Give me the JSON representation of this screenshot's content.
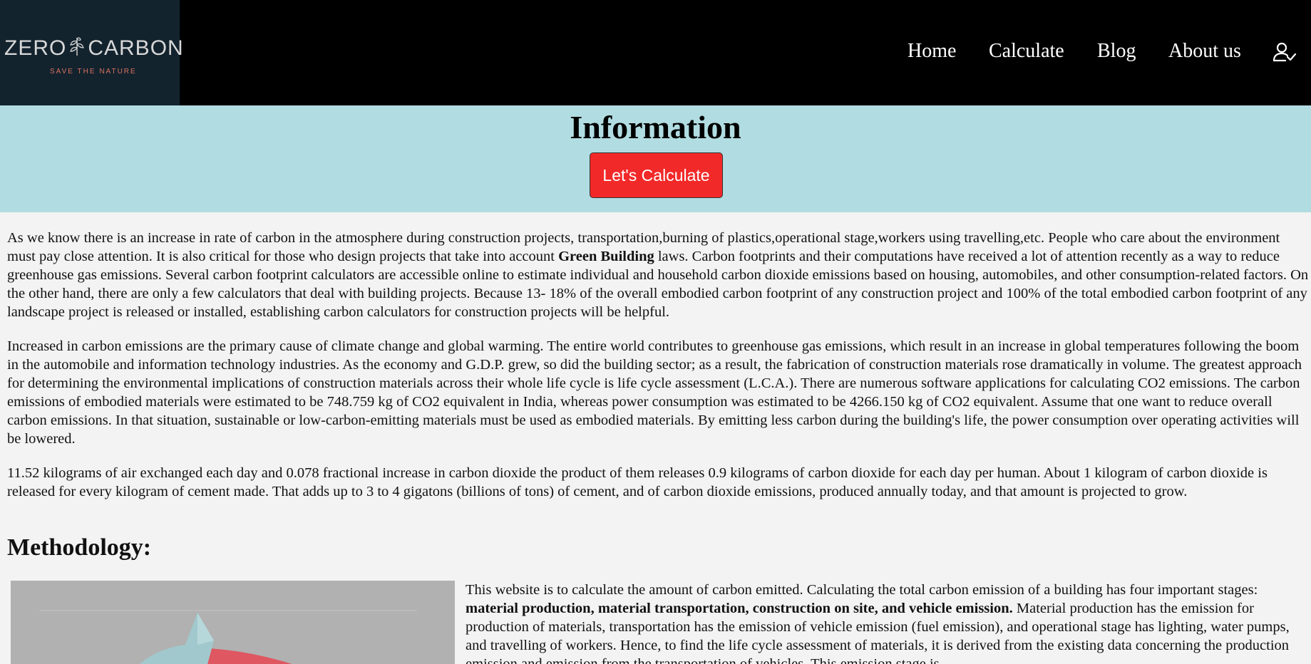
{
  "brand": {
    "name_left": "ZERO",
    "name_right": "CARBON",
    "tagline": "SAVE THE NATURE",
    "logo_icon": "leaf-icon",
    "tagline_color": "#d9705f"
  },
  "nav": {
    "items": [
      {
        "label": "Home"
      },
      {
        "label": "Calculate"
      },
      {
        "label": "Blog"
      },
      {
        "label": "About us"
      }
    ],
    "user_icon": "user-check-icon"
  },
  "hero": {
    "title": "Information",
    "button_label": "Let's Calculate",
    "bg_color": "#b1dde2",
    "button_color": "#f22929"
  },
  "content": {
    "p1_part1": "As we know there is an increase in rate of carbon in the atmosphere during construction projects, transportation,burning of plastics,operational stage,workers using travelling,etc. People who care about the environment must pay close attention. It is also critical for those who design projects that take into account ",
    "p1_bold": "Green Building",
    "p1_part2": " laws. Carbon footprints and their computations have received a lot of attention recently as a way to reduce greenhouse gas emissions. Several carbon footprint calculators are accessible online to estimate individual and household carbon dioxide emissions based on housing, automobiles, and other consumption-related factors. On the other hand, there are only a few calculators that deal with building projects. Because 13- 18% of the overall embodied carbon footprint of any construction project and 100% of the total embodied carbon footprint of any landscape project is released or installed, establishing carbon calculators for construction projects will be helpful.",
    "p2": "Increased in carbon emissions are the primary cause of climate change and global warming. The entire world contributes to greenhouse gas emissions, which result in an increase in global temperatures following the boom in the automobile and information technology industries. As the economy and G.D.P. grew, so did the building sector; as a result, the fabrication of construction materials rose dramatically in volume. The greatest approach for determining the environmental implications of construction materials across their whole life cycle is life cycle assessment (L.C.A.). There are numerous software applications for calculating CO2 emissions. The carbon emissions of embodied materials were estimated to be 748.759 kg of CO2 equivalent in India, whereas power consumption was estimated to be 4266.150 kg of CO2 equivalent. Assume that one want to reduce overall carbon emissions. In that situation, sustainable or low-carbon-emitting materials must be used as embodied materials. By emitting less carbon during the building's life, the power consumption over operating activities will be lowered.",
    "p3": "11.52 kilograms of air exchanged each day and 0.078 fractional increase in carbon dioxide the product of them releases 0.9 kilograms of carbon dioxide for each day per human. About 1 kilogram of carbon dioxide is released for every kilogram of cement made. That adds up to 3 to 4 gigatons (billions of tons) of cement, and of carbon dioxide emissions, produced annually today, and that amount is projected to grow."
  },
  "methodology": {
    "title": "Methodology:",
    "text_part1": "This website is to calculate the amount of carbon emitted. Calculating the total carbon emission of a building has four important stages: ",
    "text_bold": "material production, material transportation, construction on site, and vehicle emission.",
    "text_part2": " Material production has the emission for production of materials, transportation has the emission of vehicle emission (fuel emission), and operational stage has lighting, water pumps, and travelling of workers. Hence, to find the life cycle assessment of materials, it is derived from the existing data concerning the production emission and emission from the transportation of vehicles. This emission stage is"
  }
}
